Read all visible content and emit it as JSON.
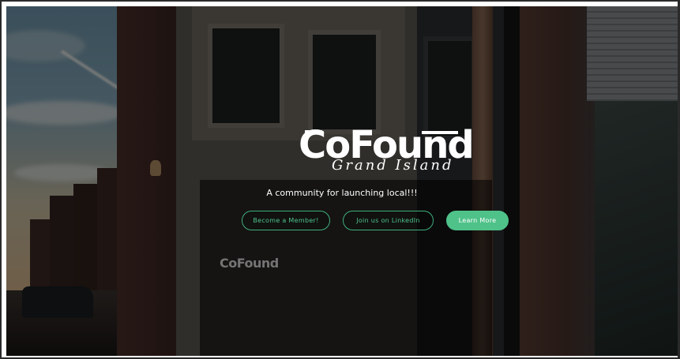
{
  "hero": {
    "logo_main": "CoFound",
    "logo_sub": "Grand Island",
    "tagline": "A community for launching local!!!"
  },
  "buttons": {
    "member": "Become a Member!",
    "linkedin": "Join us on LinkedIn",
    "learn": "Learn More"
  },
  "storefront_sign": "CoFound",
  "colors": {
    "accent": "#4fc289",
    "text": "#ffffff"
  }
}
